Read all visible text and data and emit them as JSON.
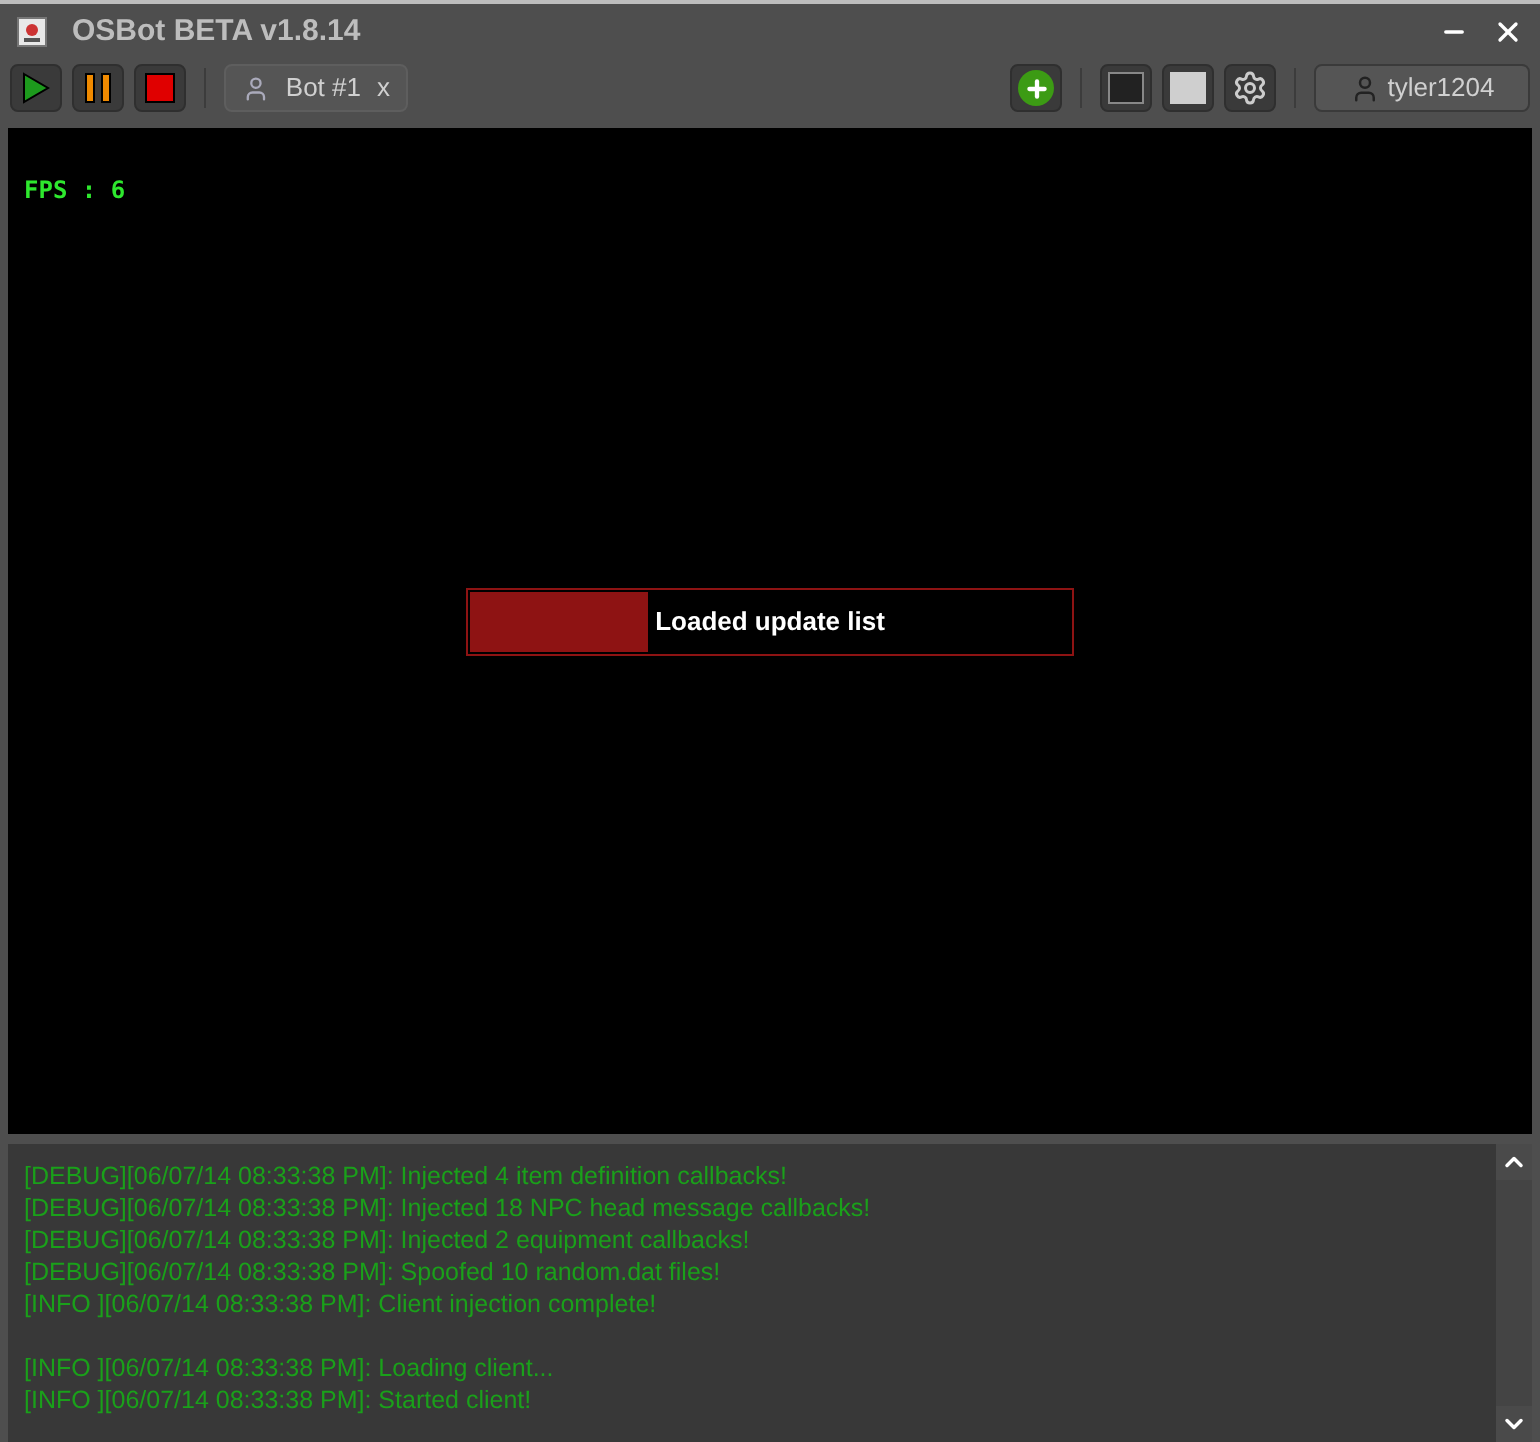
{
  "window": {
    "title": "OSBot BETA v1.8.14"
  },
  "toolbar": {
    "bot_tab": {
      "label": "Bot #1",
      "close": "x"
    },
    "user": "tyler1204"
  },
  "canvas": {
    "fps": "FPS : 6",
    "progress": {
      "label": "Loaded update list",
      "level": 0.3
    }
  },
  "log": [
    {
      "text": "[DEBUG][06/07/14 08:33:38 PM]: Injected 4 item definition callbacks!"
    },
    {
      "text": "[DEBUG][06/07/14 08:33:38 PM]: Injected 18 NPC head message callbacks!"
    },
    {
      "text": "[DEBUG][06/07/14 08:33:38 PM]: Injected 2 equipment callbacks!"
    },
    {
      "text": "[DEBUG][06/07/14 08:33:38 PM]: Spoofed 10 random.dat files!"
    },
    {
      "text": "[INFO ][06/07/14 08:33:38 PM]: Client injection complete!"
    },
    {
      "kind": "blank"
    },
    {
      "text": "[INFO ][06/07/14 08:33:38 PM]: Loading client..."
    },
    {
      "text": "[INFO ][06/07/14 08:33:38 PM]: Started client!"
    }
  ]
}
